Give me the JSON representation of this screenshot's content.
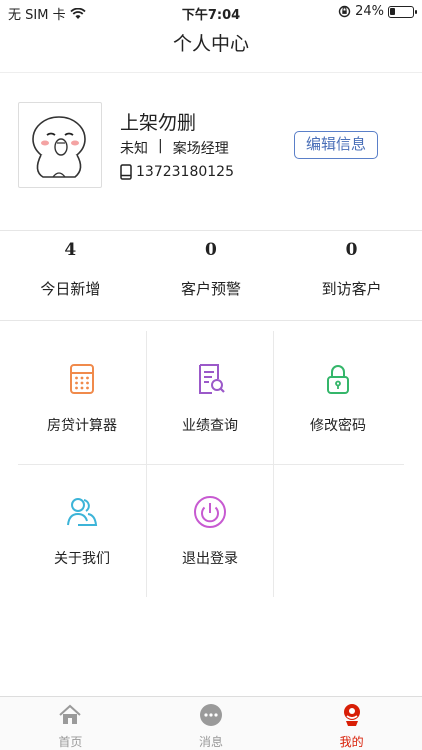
{
  "status_bar": {
    "carrier": "无 SIM 卡",
    "time": "下午7:04",
    "battery": "24%",
    "battery_level": 0.24
  },
  "nav": {
    "title": "个人中心"
  },
  "profile": {
    "name": "上架勿删",
    "gender": "未知",
    "separator": "|",
    "role": "案场经理",
    "phone": "13723180125",
    "edit_label": "编辑信息"
  },
  "stats": [
    {
      "value": "4",
      "label": "今日新增"
    },
    {
      "value": "0",
      "label": "客户预警"
    },
    {
      "value": "0",
      "label": "到访客户"
    }
  ],
  "menu": [
    {
      "label": "房贷计算器",
      "icon": "calculator-icon",
      "color": "#f08a4b"
    },
    {
      "label": "业绩查询",
      "icon": "document-search-icon",
      "color": "#9b59c9"
    },
    {
      "label": "修改密码",
      "icon": "lock-icon",
      "color": "#34b66a"
    },
    {
      "label": "关于我们",
      "icon": "users-icon",
      "color": "#3cb4d8"
    },
    {
      "label": "退出登录",
      "icon": "power-icon",
      "color": "#c75ad1"
    }
  ],
  "tabbar": [
    {
      "label": "首页",
      "icon": "home-icon"
    },
    {
      "label": "消息",
      "icon": "message-icon"
    },
    {
      "label": "我的",
      "icon": "profile-icon",
      "active_color": "#d81e06"
    }
  ]
}
